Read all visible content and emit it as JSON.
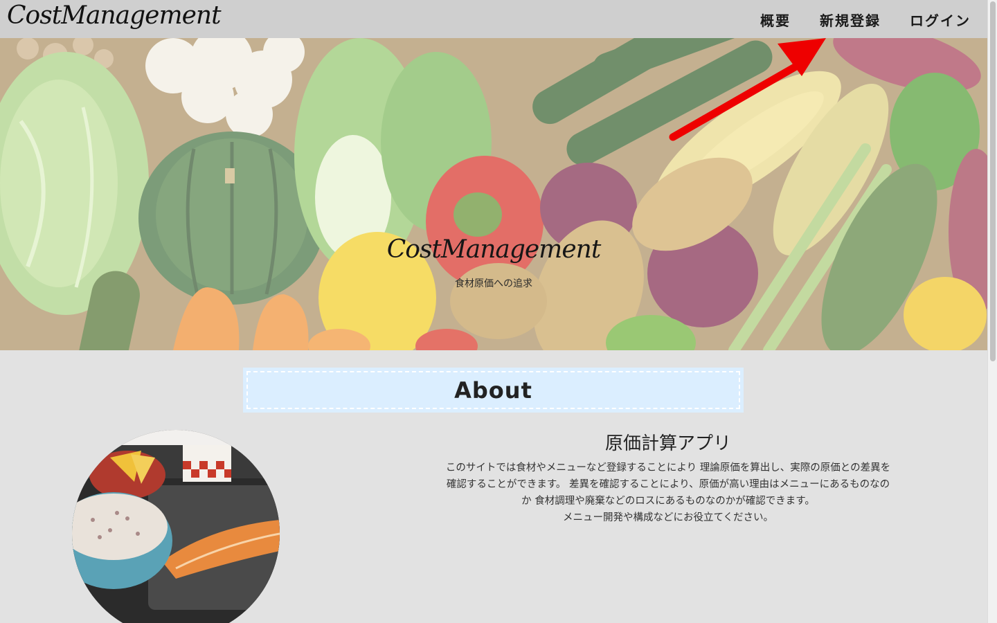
{
  "header": {
    "brand": "CostManagement",
    "nav": [
      "概要",
      "新規登録",
      "ログイン"
    ]
  },
  "hero": {
    "title": "CostManagement",
    "subtitle": "食材原価への追求"
  },
  "about": {
    "heading": "About",
    "app_title": "原価計算アプリ",
    "description": [
      "このサイトでは食材やメニューなど登録することにより 理論原価を算出し、実際の原価との差異を",
      "確認することができます。 差異を確認することにより、原価が高い理由はメニューにあるものなの",
      "か 食材調理や廃棄などのロスにあるものなのかが確認できます。",
      "メニュー開発や構成などにお役立てください。"
    ]
  },
  "annotation": {
    "arrow_color": "#ee0000"
  },
  "colors": {
    "page_bg": "#e2e2e2",
    "header_bg": "#cfcfcf",
    "about_box_bg": "#dbeeff"
  }
}
